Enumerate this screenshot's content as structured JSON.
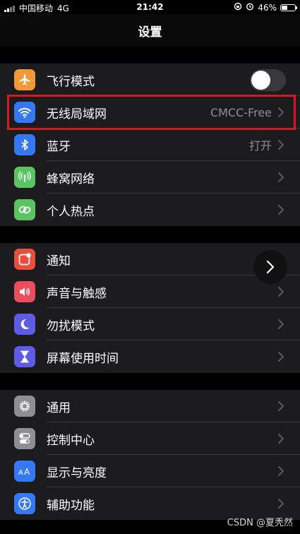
{
  "status": {
    "carrier": "中国移动",
    "network": "4G",
    "time": "21:42",
    "battery_text": "46%",
    "battery_level": 0.46
  },
  "nav": {
    "title": "设置"
  },
  "groups": [
    {
      "items": [
        {
          "label": "飞行模式",
          "icon": "airplane-icon",
          "color": "#f09a37",
          "toggle": false
        },
        {
          "label": "无线局域网",
          "icon": "wifi-icon",
          "color": "#3478f6",
          "value": "CMCC-Free",
          "highlighted": true
        },
        {
          "label": "蓝牙",
          "icon": "bluetooth-icon",
          "color": "#3478f6",
          "value": "打开"
        },
        {
          "label": "蜂窝网络",
          "icon": "cellular-icon",
          "color": "#5ac463"
        },
        {
          "label": "个人热点",
          "icon": "hotspot-icon",
          "color": "#5ac463"
        }
      ]
    },
    {
      "items": [
        {
          "label": "通知",
          "icon": "notification-icon",
          "color": "#eb4d3d"
        },
        {
          "label": "声音与触感",
          "icon": "sound-icon",
          "color": "#eb4d5f"
        },
        {
          "label": "勿扰模式",
          "icon": "moon-icon",
          "color": "#5e5ce6"
        },
        {
          "label": "屏幕使用时间",
          "icon": "hourglass-icon",
          "color": "#5e5ce6"
        }
      ]
    },
    {
      "items": [
        {
          "label": "通用",
          "icon": "gear-icon",
          "color": "#8e8e93"
        },
        {
          "label": "控制中心",
          "icon": "switches-icon",
          "color": "#8e8e93"
        },
        {
          "label": "显示与亮度",
          "icon": "text-size-icon",
          "color": "#3478f6"
        },
        {
          "label": "辅助功能",
          "icon": "accessibility-icon",
          "color": "#3478f6"
        }
      ]
    }
  ],
  "watermark": "CSDN @夏秃然"
}
